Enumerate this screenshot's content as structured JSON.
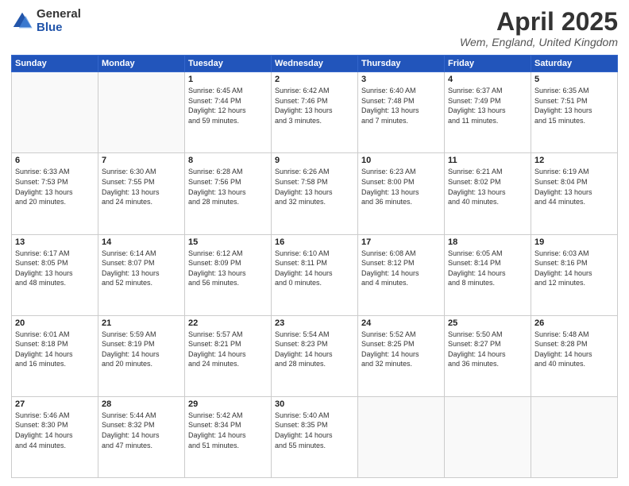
{
  "header": {
    "logo_general": "General",
    "logo_blue": "Blue",
    "title": "April 2025",
    "location": "Wem, England, United Kingdom"
  },
  "weekdays": [
    "Sunday",
    "Monday",
    "Tuesday",
    "Wednesday",
    "Thursday",
    "Friday",
    "Saturday"
  ],
  "weeks": [
    [
      {
        "day": "",
        "info": ""
      },
      {
        "day": "",
        "info": ""
      },
      {
        "day": "1",
        "info": "Sunrise: 6:45 AM\nSunset: 7:44 PM\nDaylight: 12 hours\nand 59 minutes."
      },
      {
        "day": "2",
        "info": "Sunrise: 6:42 AM\nSunset: 7:46 PM\nDaylight: 13 hours\nand 3 minutes."
      },
      {
        "day": "3",
        "info": "Sunrise: 6:40 AM\nSunset: 7:48 PM\nDaylight: 13 hours\nand 7 minutes."
      },
      {
        "day": "4",
        "info": "Sunrise: 6:37 AM\nSunset: 7:49 PM\nDaylight: 13 hours\nand 11 minutes."
      },
      {
        "day": "5",
        "info": "Sunrise: 6:35 AM\nSunset: 7:51 PM\nDaylight: 13 hours\nand 15 minutes."
      }
    ],
    [
      {
        "day": "6",
        "info": "Sunrise: 6:33 AM\nSunset: 7:53 PM\nDaylight: 13 hours\nand 20 minutes."
      },
      {
        "day": "7",
        "info": "Sunrise: 6:30 AM\nSunset: 7:55 PM\nDaylight: 13 hours\nand 24 minutes."
      },
      {
        "day": "8",
        "info": "Sunrise: 6:28 AM\nSunset: 7:56 PM\nDaylight: 13 hours\nand 28 minutes."
      },
      {
        "day": "9",
        "info": "Sunrise: 6:26 AM\nSunset: 7:58 PM\nDaylight: 13 hours\nand 32 minutes."
      },
      {
        "day": "10",
        "info": "Sunrise: 6:23 AM\nSunset: 8:00 PM\nDaylight: 13 hours\nand 36 minutes."
      },
      {
        "day": "11",
        "info": "Sunrise: 6:21 AM\nSunset: 8:02 PM\nDaylight: 13 hours\nand 40 minutes."
      },
      {
        "day": "12",
        "info": "Sunrise: 6:19 AM\nSunset: 8:04 PM\nDaylight: 13 hours\nand 44 minutes."
      }
    ],
    [
      {
        "day": "13",
        "info": "Sunrise: 6:17 AM\nSunset: 8:05 PM\nDaylight: 13 hours\nand 48 minutes."
      },
      {
        "day": "14",
        "info": "Sunrise: 6:14 AM\nSunset: 8:07 PM\nDaylight: 13 hours\nand 52 minutes."
      },
      {
        "day": "15",
        "info": "Sunrise: 6:12 AM\nSunset: 8:09 PM\nDaylight: 13 hours\nand 56 minutes."
      },
      {
        "day": "16",
        "info": "Sunrise: 6:10 AM\nSunset: 8:11 PM\nDaylight: 14 hours\nand 0 minutes."
      },
      {
        "day": "17",
        "info": "Sunrise: 6:08 AM\nSunset: 8:12 PM\nDaylight: 14 hours\nand 4 minutes."
      },
      {
        "day": "18",
        "info": "Sunrise: 6:05 AM\nSunset: 8:14 PM\nDaylight: 14 hours\nand 8 minutes."
      },
      {
        "day": "19",
        "info": "Sunrise: 6:03 AM\nSunset: 8:16 PM\nDaylight: 14 hours\nand 12 minutes."
      }
    ],
    [
      {
        "day": "20",
        "info": "Sunrise: 6:01 AM\nSunset: 8:18 PM\nDaylight: 14 hours\nand 16 minutes."
      },
      {
        "day": "21",
        "info": "Sunrise: 5:59 AM\nSunset: 8:19 PM\nDaylight: 14 hours\nand 20 minutes."
      },
      {
        "day": "22",
        "info": "Sunrise: 5:57 AM\nSunset: 8:21 PM\nDaylight: 14 hours\nand 24 minutes."
      },
      {
        "day": "23",
        "info": "Sunrise: 5:54 AM\nSunset: 8:23 PM\nDaylight: 14 hours\nand 28 minutes."
      },
      {
        "day": "24",
        "info": "Sunrise: 5:52 AM\nSunset: 8:25 PM\nDaylight: 14 hours\nand 32 minutes."
      },
      {
        "day": "25",
        "info": "Sunrise: 5:50 AM\nSunset: 8:27 PM\nDaylight: 14 hours\nand 36 minutes."
      },
      {
        "day": "26",
        "info": "Sunrise: 5:48 AM\nSunset: 8:28 PM\nDaylight: 14 hours\nand 40 minutes."
      }
    ],
    [
      {
        "day": "27",
        "info": "Sunrise: 5:46 AM\nSunset: 8:30 PM\nDaylight: 14 hours\nand 44 minutes."
      },
      {
        "day": "28",
        "info": "Sunrise: 5:44 AM\nSunset: 8:32 PM\nDaylight: 14 hours\nand 47 minutes."
      },
      {
        "day": "29",
        "info": "Sunrise: 5:42 AM\nSunset: 8:34 PM\nDaylight: 14 hours\nand 51 minutes."
      },
      {
        "day": "30",
        "info": "Sunrise: 5:40 AM\nSunset: 8:35 PM\nDaylight: 14 hours\nand 55 minutes."
      },
      {
        "day": "",
        "info": ""
      },
      {
        "day": "",
        "info": ""
      },
      {
        "day": "",
        "info": ""
      }
    ]
  ]
}
